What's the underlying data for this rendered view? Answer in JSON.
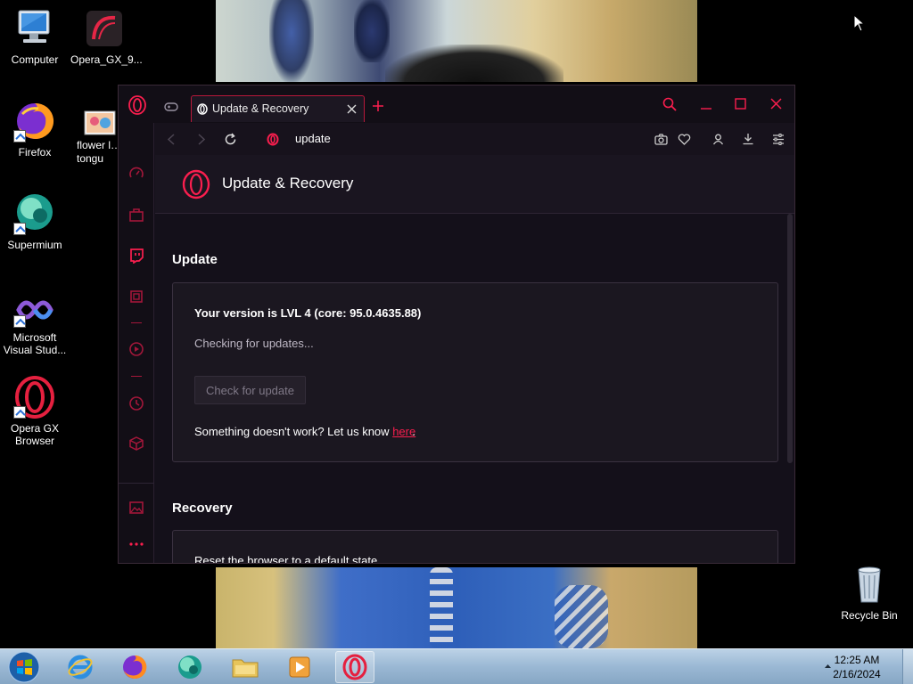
{
  "desktop": {
    "icons": [
      {
        "label": "Computer"
      },
      {
        "label": "Opera_GX_9..."
      },
      {
        "label": "Firefox"
      },
      {
        "label": "flower l… tongu"
      },
      {
        "label": "Supermium"
      },
      {
        "label": "Microsoft Visual Stud..."
      },
      {
        "label": "Opera GX Browser"
      },
      {
        "label": "Recycle Bin"
      }
    ]
  },
  "browser": {
    "tab_title": "Update & Recovery",
    "address": "update",
    "page": {
      "header_title": "Update & Recovery",
      "update_section_title": "Update",
      "version_label": "Your version is",
      "version_value": "LVL 4 (core: 95.0.4635.88)",
      "status": "Checking for updates...",
      "check_button": "Check for update",
      "feedback_prefix": "Something doesn't work? Let us know",
      "feedback_link": "here",
      "feedback_suffix": ".",
      "recovery_section_title": "Recovery",
      "recovery_text": "Reset the browser to a default state"
    }
  },
  "taskbar": {
    "time": "12:25 AM",
    "date": "2/16/2024"
  },
  "colors": {
    "accent": "#fa1e4e",
    "window_bg": "#14101a",
    "card_bg": "#1b1720"
  }
}
